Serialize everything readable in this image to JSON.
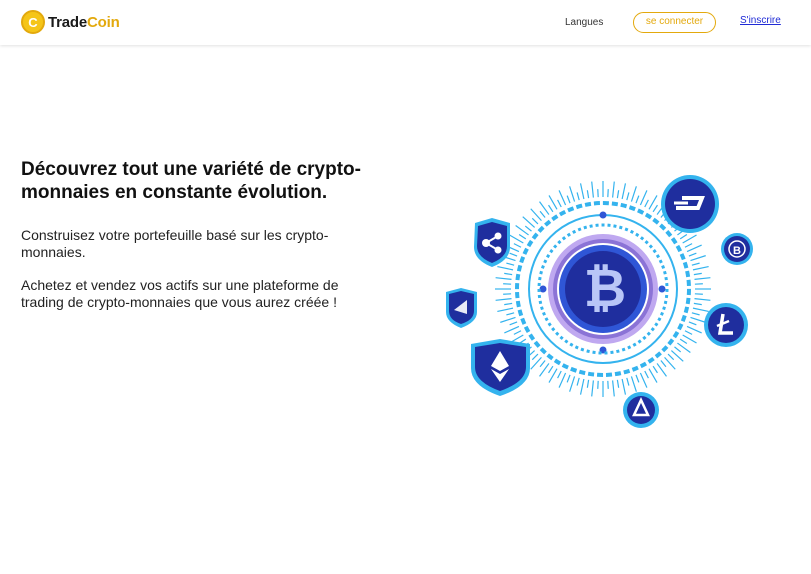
{
  "brand": {
    "name_part1": "Trade",
    "name_part2": "Coin",
    "mark": "C"
  },
  "nav": {
    "languages": "Langues",
    "login": "se connecter",
    "signup": "S'inscrire"
  },
  "hero": {
    "title": "Découvrez tout une variété de crypto-monnaies en constante évolution.",
    "paragraph1": "Construisez votre portefeuille basé sur les crypto-monnaies.",
    "paragraph2": "Achetez et vendez vos actifs sur une plateforme de trading de crypto-monnaies que vous aurez créée !"
  },
  "illustration": {
    "center_symbol": "₿",
    "coins": [
      "ripple-icon",
      "dash-icon",
      "bytecoin-icon",
      "litecoin-icon",
      "lisk-icon",
      "ethereum-icon",
      "waves-icon"
    ],
    "colors": {
      "navy": "#1f2e9e",
      "blue": "#2f56d6",
      "cyan": "#34b3ee",
      "purple": "#8b73d6",
      "lavender": "#bfa8f0",
      "accent": "#e3a90d",
      "link": "#1f2bd6"
    }
  }
}
